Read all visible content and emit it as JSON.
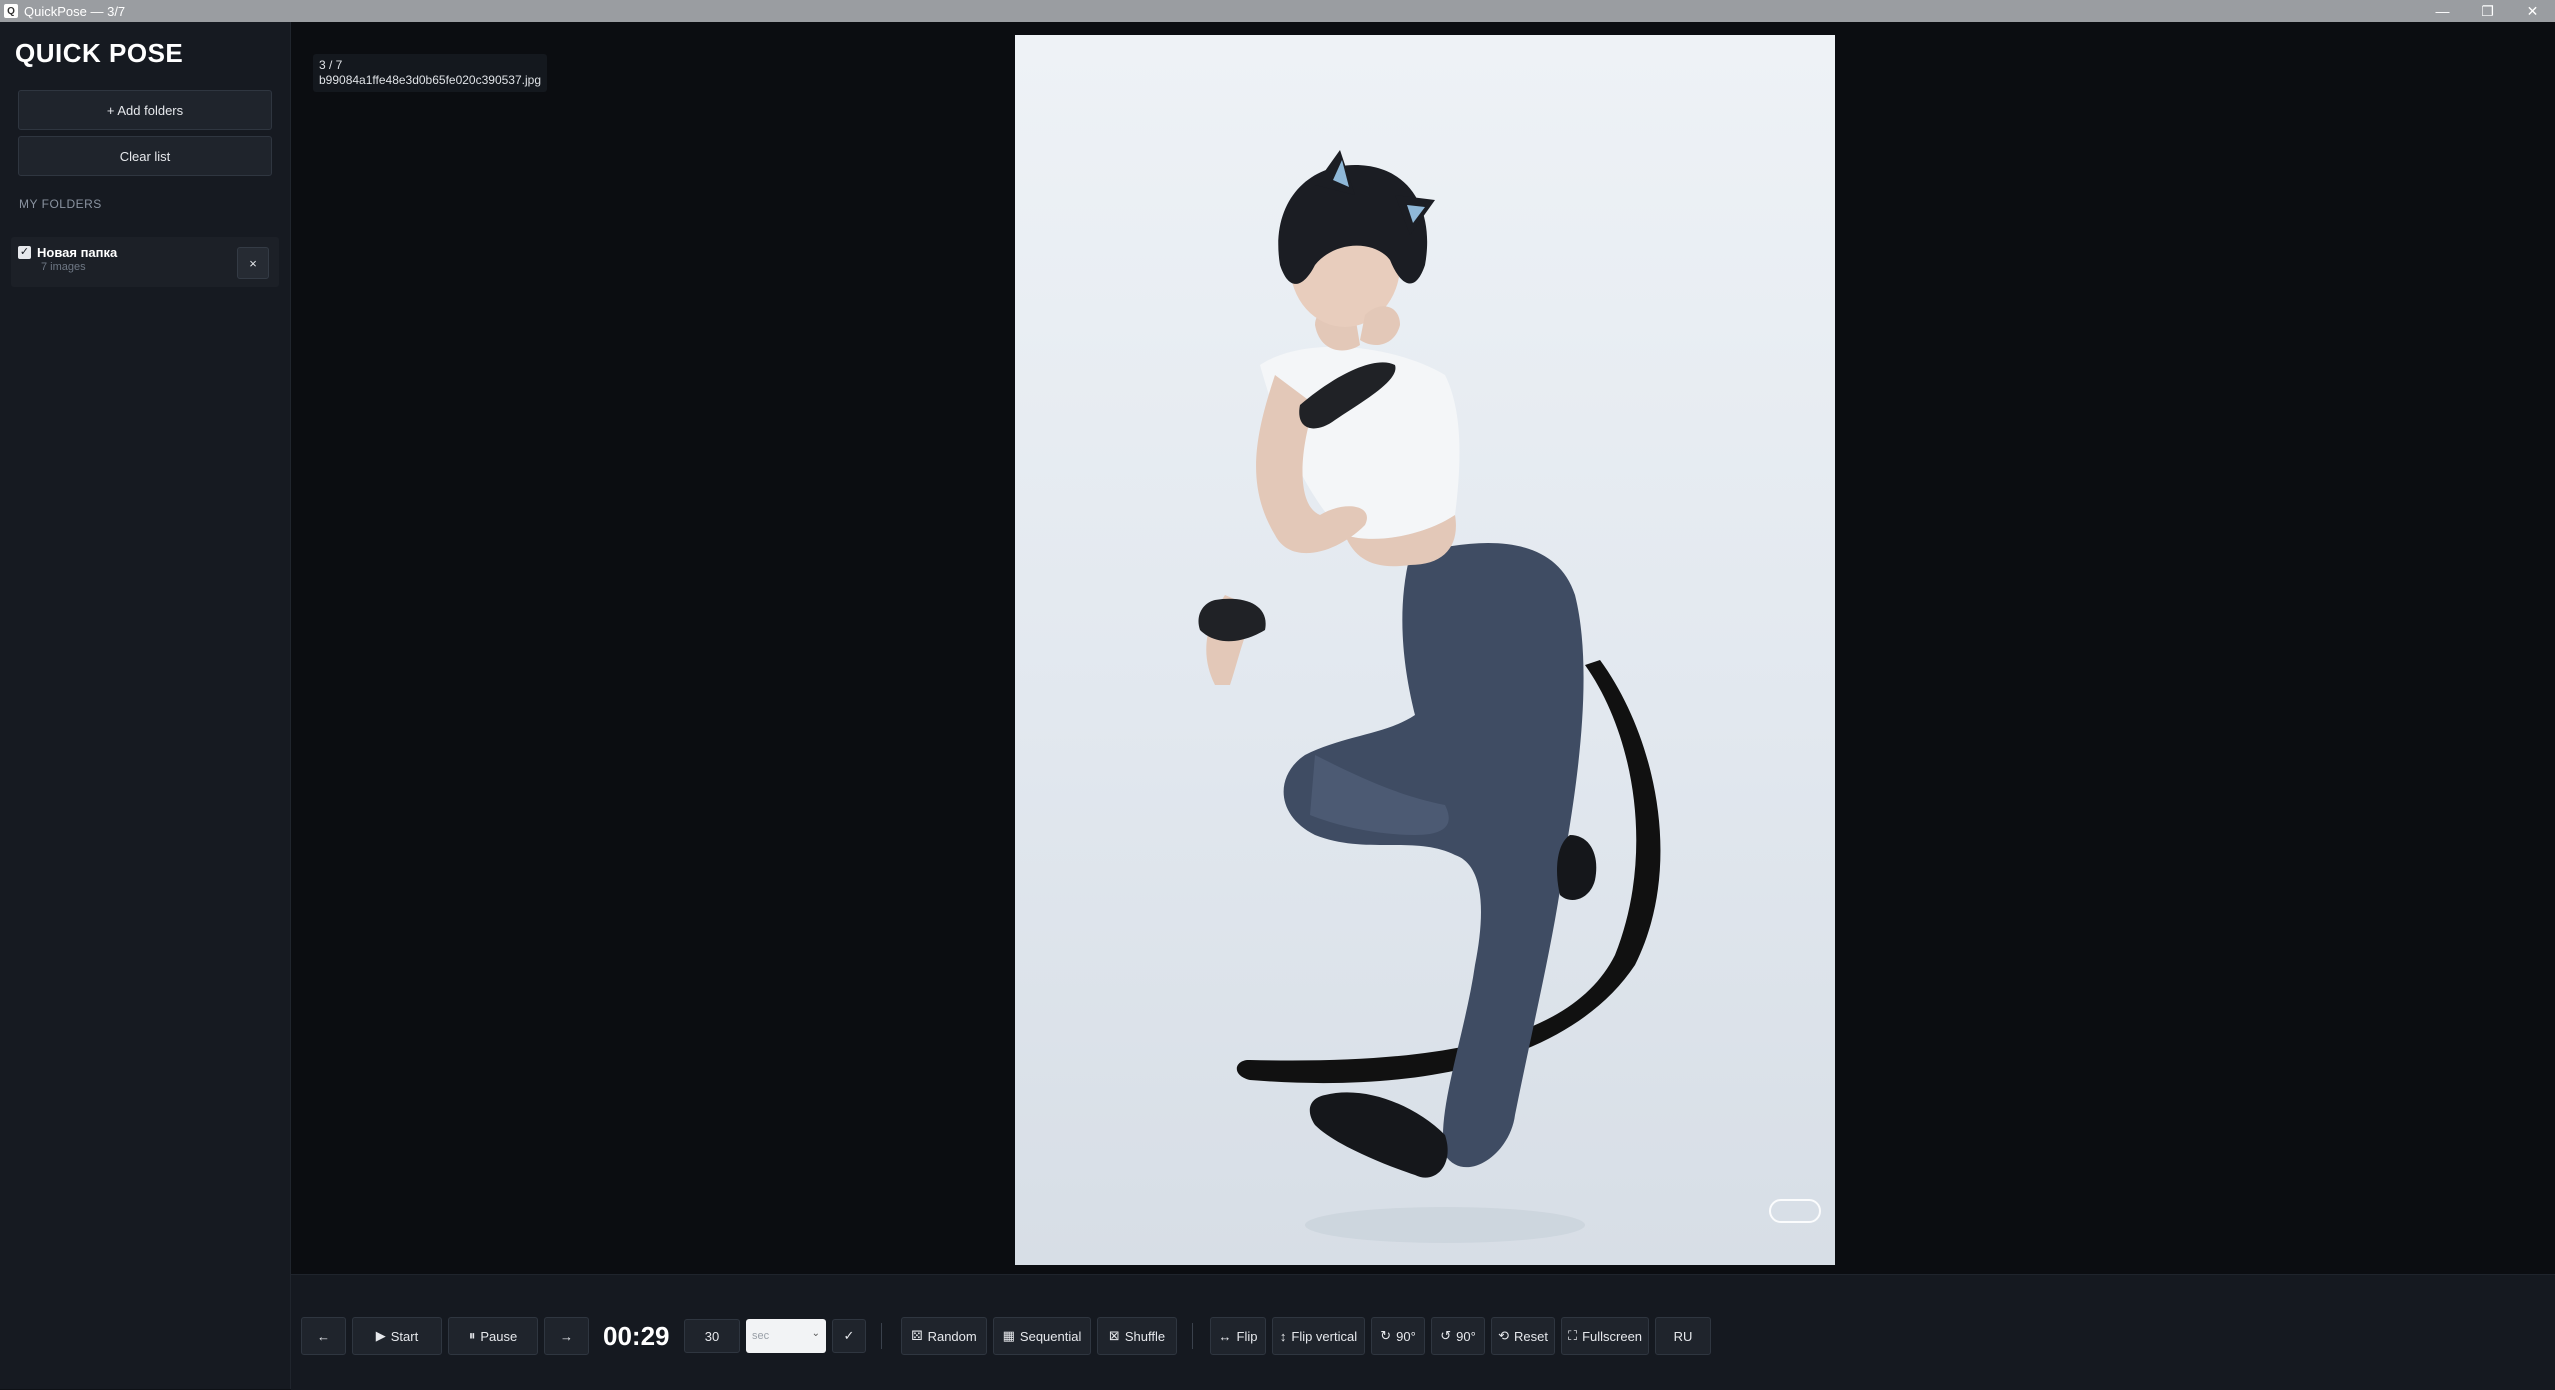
{
  "window": {
    "title": "QuickPose — 3/7",
    "app_icon": "Q",
    "controls": {
      "minimize": "—",
      "maximize": "❐",
      "close": "✕"
    }
  },
  "sidebar": {
    "logo": "QUICK POSE",
    "add_folders_label": "+ Add folders",
    "clear_list_label": "Clear list",
    "section_title": "MY FOLDERS",
    "folders": [
      {
        "name": "Новая папка",
        "count": "7 images",
        "checked": true,
        "remove_label": "×"
      }
    ]
  },
  "viewer": {
    "counter": "3 / 7",
    "filename": "b99084a1ffe48e3d0b65fe020c390537.jpg"
  },
  "toolbar": {
    "prev_label": "←",
    "start_label": "Start",
    "start_icon": "▶",
    "pause_label": "Pause",
    "pause_icon": "⏸",
    "next_label": "→",
    "timer": "00:29",
    "duration_value": "30",
    "unit_selected": "sec",
    "apply_label": "✓",
    "random_label": "Random",
    "random_icon": "⚄",
    "sequential_label": "Sequential",
    "sequential_icon": "▦",
    "shuffle_label": "Shuffle",
    "shuffle_icon": "⊠",
    "flip_label": "Flip",
    "flip_icon": "↔",
    "flip_vertical_label": "Flip vertical",
    "flip_vertical_icon": "↕",
    "rotate_cw_label": "90°",
    "rotate_cw_icon": "↻",
    "rotate_ccw_label": "90°",
    "rotate_ccw_icon": "↺",
    "reset_label": "Reset",
    "reset_icon": "⟲",
    "fullscreen_label": "Fullscreen",
    "fullscreen_icon": "⛶",
    "lang_label": "RU"
  },
  "colors": {
    "background": "#0e1116",
    "sidebar": "#161a21",
    "button": "#1f242c",
    "border": "#2f3640"
  }
}
